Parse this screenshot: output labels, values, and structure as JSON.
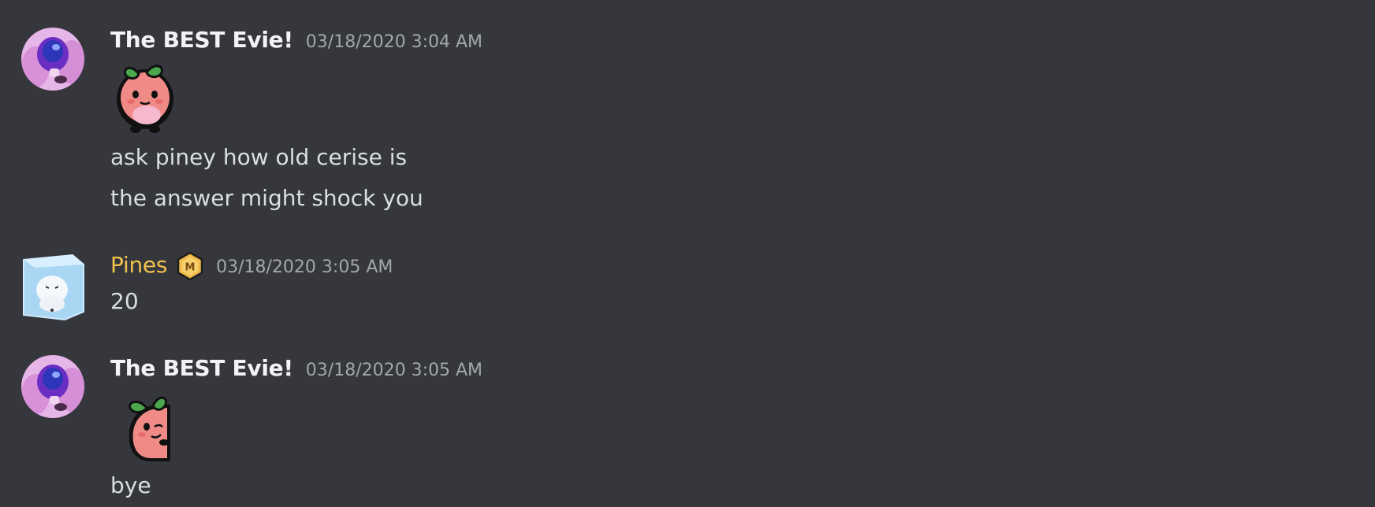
{
  "messages": [
    {
      "author": "The BEST Evie!",
      "timestamp": "03/18/2020 3:04 AM",
      "sticker": "peach-sticker",
      "lines": [
        "ask piney how old cerise is",
        "the answer might shock you"
      ]
    },
    {
      "author": "Pines",
      "timestamp": "03/18/2020 3:05 AM",
      "badge_letter": "M",
      "lines": [
        "20"
      ]
    },
    {
      "author": "The BEST Evie!",
      "timestamp": "03/18/2020 3:05 AM",
      "sticker": "peach-peek-sticker",
      "lines": [
        "bye"
      ]
    }
  ],
  "colors": {
    "background": "#36373d",
    "username": "#f2f3f5",
    "pines_username": "#f0c24b",
    "timestamp": "#a3a6aa",
    "message_text": "#dbdee1"
  }
}
